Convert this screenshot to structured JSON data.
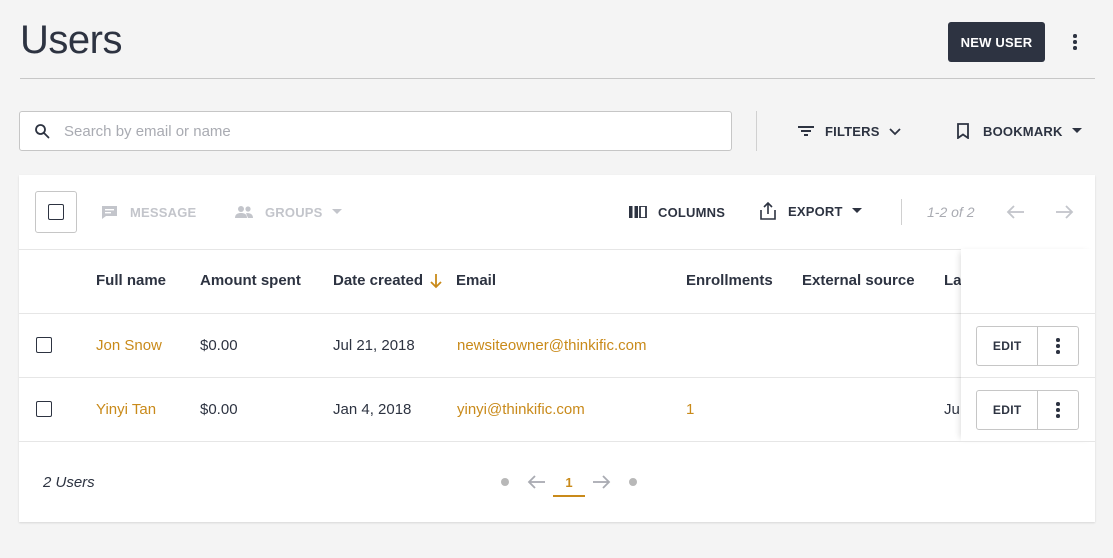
{
  "header": {
    "title": "Users",
    "new_user_label": "NEW USER"
  },
  "search": {
    "placeholder": "Search by email or name",
    "value": ""
  },
  "toolbar": {
    "filters_label": "FILTERS",
    "bookmark_label": "BOOKMARK"
  },
  "table_toolbar": {
    "message_label": "MESSAGE",
    "groups_label": "GROUPS",
    "columns_label": "COLUMNS",
    "export_label": "EXPORT",
    "range_text": "1-2 of 2"
  },
  "table": {
    "columns": [
      "Full name",
      "Amount spent",
      "Date created",
      "Email",
      "Enrollments",
      "External source",
      "La"
    ],
    "sort_column": "Date created",
    "rows": [
      {
        "full_name": "Jon Snow",
        "amount_spent": "$0.00",
        "date_created": "Jul 21, 2018",
        "email": "newsiteowner@thinkific.com",
        "enrollments": "",
        "external_source": "",
        "last": ""
      },
      {
        "full_name": "Yinyi Tan",
        "amount_spent": "$0.00",
        "date_created": "Jan 4, 2018",
        "email": "yinyi@thinkific.com",
        "enrollments": "1",
        "external_source": "",
        "last": "Ju"
      }
    ],
    "edit_label": "EDIT"
  },
  "footer": {
    "count_text": "2 Users",
    "current_page": "1"
  },
  "colors": {
    "primary": "#2d3341",
    "link": "#c98a1a",
    "disabled": "#c3c5cb",
    "background": "#f4f4f4"
  }
}
